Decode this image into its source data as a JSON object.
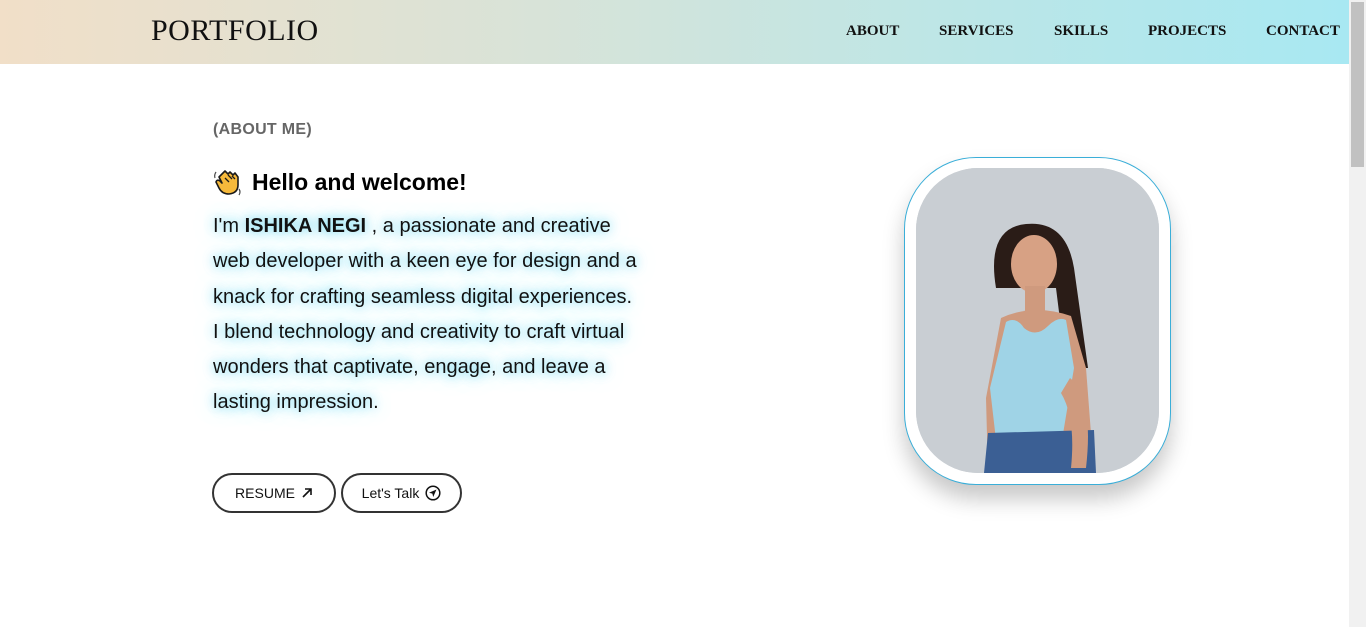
{
  "nav": {
    "brand": "PORTFOLIO",
    "links": [
      "ABOUT",
      "SERVICES",
      "SKILLS",
      "PROJECTS",
      "CONTACT"
    ]
  },
  "about": {
    "tag": "(ABOUT ME)",
    "welcome": "Hello and welcome!",
    "intro_prefix": "I'm ",
    "name": "ISHIKA NEGI",
    "intro_body": " , a passionate and creative web developer with a keen eye for design and a knack for crafting seamless digital experiences. I blend technology and creativity to craft virtual wonders that captivate, engage, and leave a lasting impression."
  },
  "buttons": {
    "resume_label": "RESUME",
    "resume_icon": "arrow-up-right-icon",
    "talk_label": "Let's Talk",
    "talk_icon": "send-circle-icon"
  },
  "icons": {
    "welcome_icon": "waving-hand-icon"
  },
  "colors": {
    "nav_gradient_start": "#f1dfc8",
    "nav_gradient_end": "#a8e8f2",
    "frame_border": "#3aaed8",
    "text_glow": "#60d7f2",
    "button_border": "#333333"
  }
}
